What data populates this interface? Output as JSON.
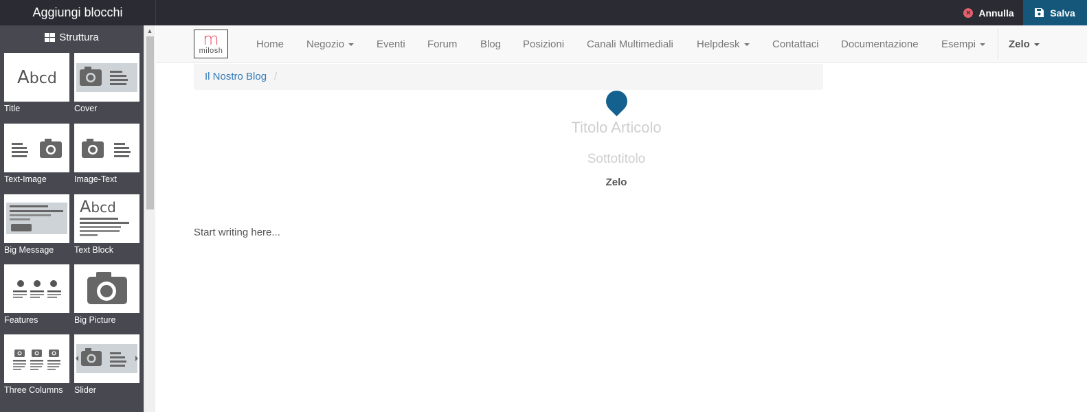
{
  "topbar": {
    "title": "Aggiungi blocchi",
    "cancel_label": "Annulla",
    "save_label": "Salva"
  },
  "sidebar": {
    "section_title": "Struttura",
    "blocks": [
      {
        "label": "Title",
        "icon": "title-abcd-icon"
      },
      {
        "label": "Cover",
        "icon": "cover-icon"
      },
      {
        "label": "Text-Image",
        "icon": "text-image-icon"
      },
      {
        "label": "Image-Text",
        "icon": "image-text-icon"
      },
      {
        "label": "Big Message",
        "icon": "big-message-icon"
      },
      {
        "label": "Text Block",
        "icon": "text-block-icon"
      },
      {
        "label": "Features",
        "icon": "features-icon"
      },
      {
        "label": "Big Picture",
        "icon": "big-picture-icon"
      },
      {
        "label": "Three Columns",
        "icon": "three-columns-icon"
      },
      {
        "label": "Slider",
        "icon": "slider-icon"
      }
    ],
    "abcd_text": "Abcd"
  },
  "navbar": {
    "logo_letter": "m",
    "logo_name": "milosh",
    "items": [
      {
        "label": "Home"
      },
      {
        "label": "Negozio"
      },
      {
        "label": "Eventi"
      },
      {
        "label": "Forum"
      },
      {
        "label": "Blog"
      },
      {
        "label": "Posizioni"
      },
      {
        "label": "Canali Multimediali"
      },
      {
        "label": "Helpdesk"
      },
      {
        "label": "Contattaci"
      },
      {
        "label": "Documentazione"
      },
      {
        "label": "Esempi"
      },
      {
        "label": "Zelo"
      }
    ]
  },
  "breadcrumb": {
    "link": "Il Nostro Blog",
    "separator": "/"
  },
  "article": {
    "title_placeholder": "Titolo Articolo",
    "subtitle_placeholder": "Sottotitolo",
    "author": "Zelo",
    "body_placeholder": "Start writing here..."
  },
  "colors": {
    "topbar_bg": "#2b2b33",
    "sidebar_bg": "#484851",
    "save_bg": "#14577a",
    "cancel_icon": "#e0606b",
    "link": "#337ab7",
    "pin": "#14618f"
  }
}
